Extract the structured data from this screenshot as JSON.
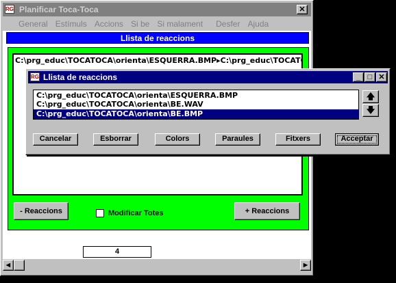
{
  "main_window": {
    "title": "Planificar Toca-Toca",
    "app_icon_text": "RG",
    "close_glyph": "✕",
    "menu": [
      "General",
      "Estímuls",
      "Accions",
      "Si be",
      "Si malament",
      "Desfer",
      "Ajuda"
    ],
    "banner": "Llista de reaccions",
    "list_row": "C:\\prg_educ\\TOCATOCA\\orienta\\ESQUERRA.BMP▸C:\\prg_educ\\TOCATOCA",
    "minus_button": "- Reaccions",
    "plus_button": "+ Reaccions",
    "checkbox_label": "Modificar Totes",
    "counter": "4",
    "scroll_left_glyph": "◀",
    "scroll_right_glyph": "▶"
  },
  "dialog": {
    "title": "Llista de reaccions",
    "min_glyph": "_",
    "max_glyph": "□",
    "close_glyph": "✕",
    "items": [
      "C:\\prg_educ\\TOCATOCA\\orienta\\ESQUERRA.BMP",
      "C:\\prg_educ\\TOCATOCA\\orienta\\BE.WAV",
      "C:\\prg_educ\\TOCATOCA\\orienta\\BE.BMP"
    ],
    "up_glyph": "🡅",
    "down_glyph": "🡇",
    "buttons": {
      "cancel": "Cancelar",
      "delete": "Esborrar",
      "colors": "Colors",
      "words": "Paraules",
      "files": "Fitxers",
      "accept": "Acceptar"
    }
  },
  "colors": {
    "green_panel": "#00ff00",
    "selection": "#000080",
    "banner": "#0000ff"
  }
}
